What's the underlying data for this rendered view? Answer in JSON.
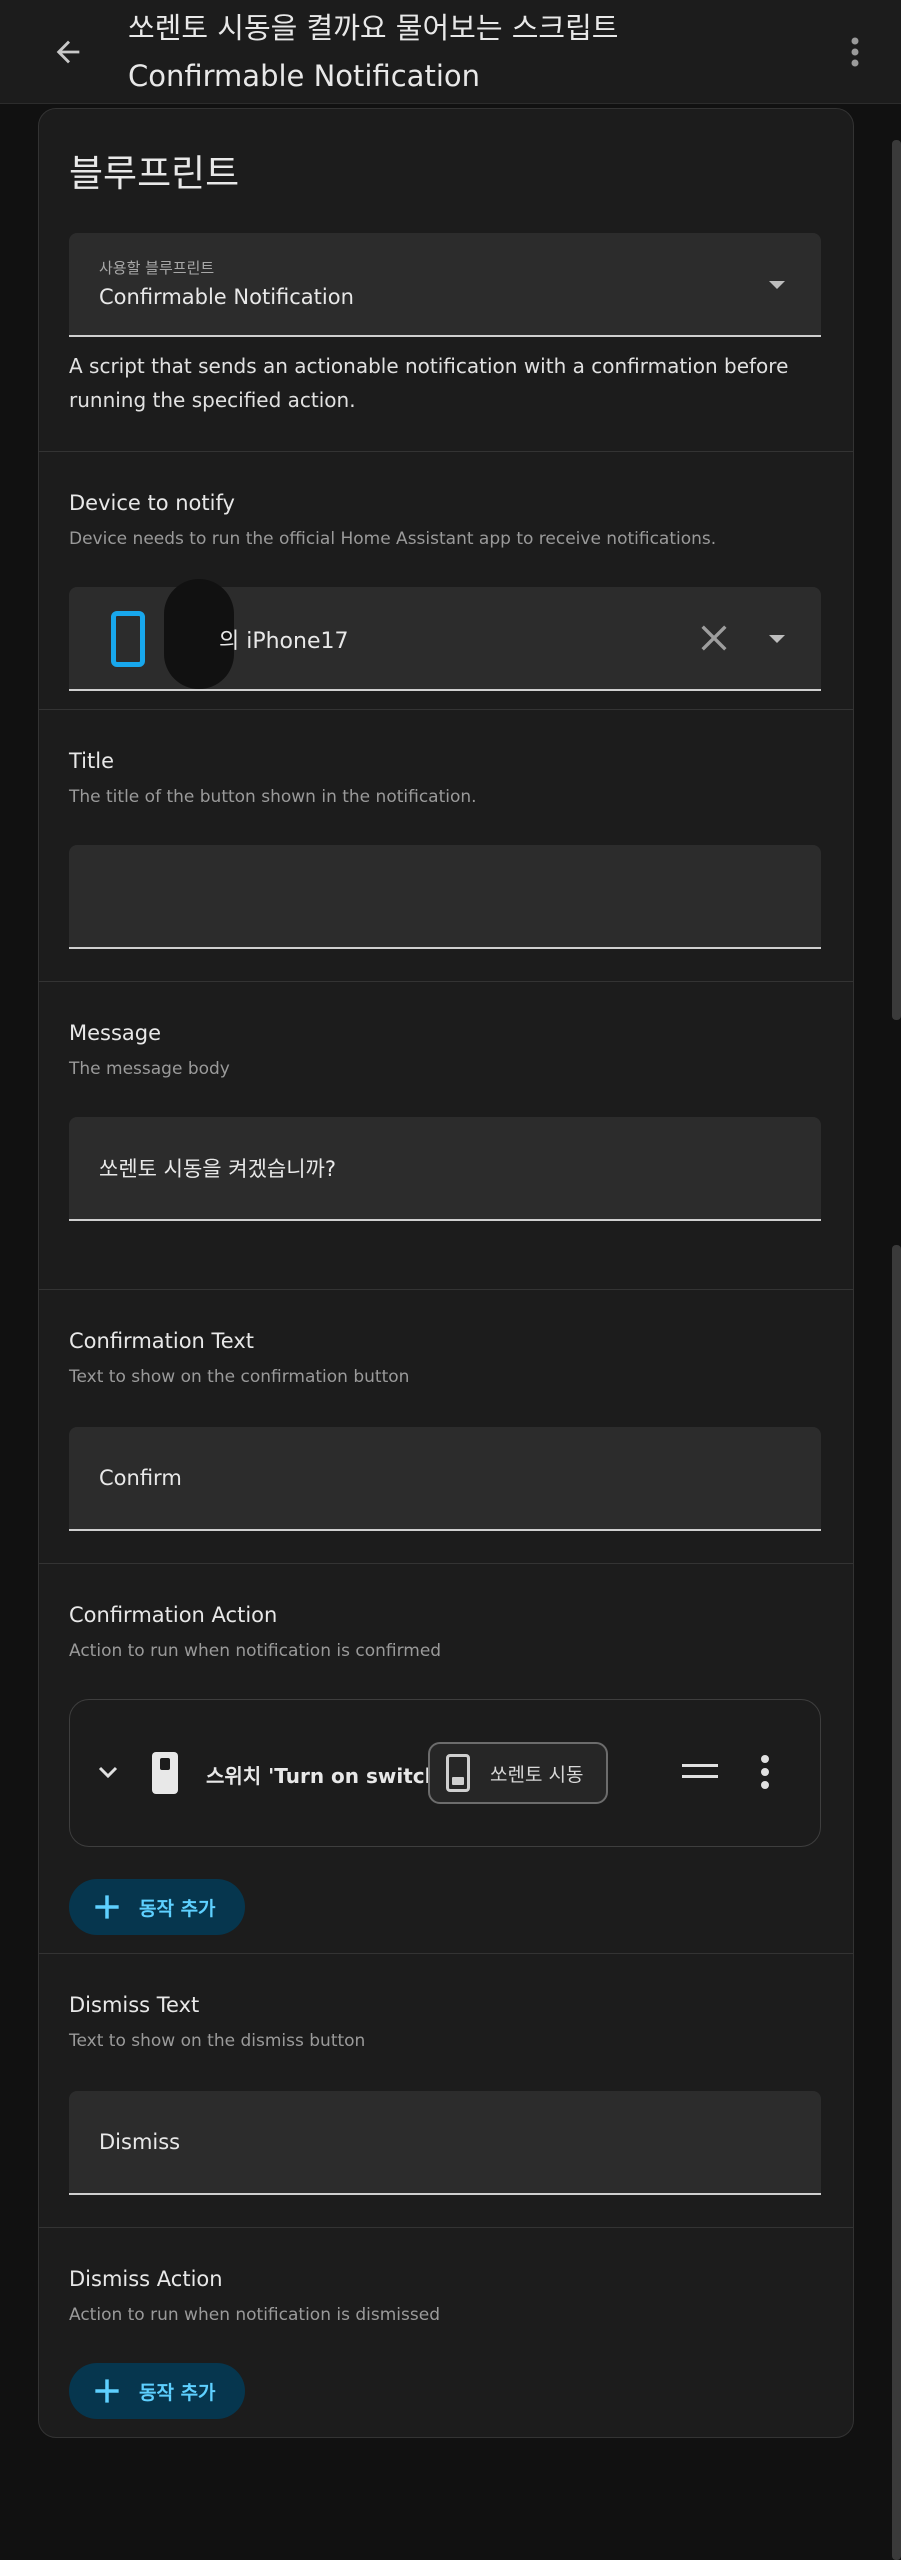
{
  "appbar": {
    "title_line1": "쏘렌토 시동을 켤까요 물어보는 스크립트",
    "title_line2": "Confirmable Notification"
  },
  "card": {
    "title": "블루프린트",
    "blueprint_field": {
      "label": "사용할 블루프린트",
      "value": "Confirmable Notification"
    },
    "blueprint_description": "A script that sends an actionable notification with a confirmation before running the specified action.",
    "device": {
      "title": "Device to notify",
      "subtitle": "Device needs to run the official Home Assistant app to receive notifications.",
      "value": "의 iPhone17"
    },
    "title_section": {
      "title": "Title",
      "subtitle": "The title of the button shown in the notification.",
      "value": ""
    },
    "message": {
      "title": "Message",
      "subtitle": "The message body",
      "value": "쏘렌토 시동을 켜겠습니까?"
    },
    "confirmation_text": {
      "title": "Confirmation Text",
      "subtitle": "Text to show on the confirmation button",
      "value": "Confirm"
    },
    "confirmation_action": {
      "title": "Confirmation Action",
      "subtitle": "Action to run when notification is confirmed",
      "action_label": "스위치 'Turn on switch'",
      "chip_label": "쏘렌토 시동",
      "add_label": "동작 추가"
    },
    "dismiss_text": {
      "title": "Dismiss Text",
      "subtitle": "Text to show on the dismiss button",
      "value": "Dismiss"
    },
    "dismiss_action": {
      "title": "Dismiss Action",
      "subtitle": "Action to run when notification is dismissed",
      "add_label": "동작 추가"
    }
  },
  "colors": {
    "background": "#111111",
    "card": "#1c1c1c",
    "field": "#2c2c2c",
    "accent": "#18a7ec",
    "add_button_bg": "#06364e",
    "add_button_text": "#5ed0ff"
  }
}
